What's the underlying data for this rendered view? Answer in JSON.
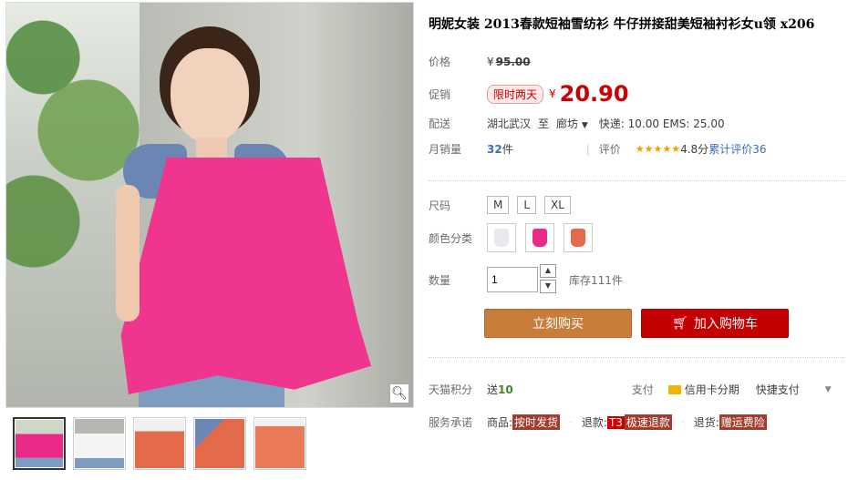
{
  "product": {
    "title": "明妮女装 2013春款短袖雪纺衫 牛仔拼接甜美短袖衬衫女u领 x206"
  },
  "price_row": {
    "label": "价格",
    "currency": "¥",
    "original": "95.00"
  },
  "promo_row": {
    "label": "促销",
    "badge": "限时两天",
    "currency": "¥",
    "price": "20.90"
  },
  "delivery_row": {
    "label": "配送",
    "from": "湖北武汉",
    "to_word": "至",
    "destination": "廊坊",
    "fees": "快递: 10.00 EMS: 25.00"
  },
  "sales_row": {
    "label": "月销量",
    "count": "32",
    "unit": "件",
    "rating_label": "评价",
    "stars": "★★★★★",
    "rating_text": "4.8分",
    "reviews": "累计评价36"
  },
  "size_row": {
    "label": "尺码",
    "options": [
      "M",
      "L",
      "XL"
    ]
  },
  "color_row": {
    "label": "颜色分类",
    "colors": [
      "#e8e8ee",
      "#ea2a86",
      "#e36b4c"
    ]
  },
  "quantity_row": {
    "label": "数量",
    "value": "1",
    "stock": "库存111件"
  },
  "buttons": {
    "buy_now": "立刻购买",
    "add_cart": "加入购物车"
  },
  "points_row": {
    "label": "天猫积分",
    "send": "送",
    "points": "10",
    "pay_label": "支付",
    "credit": "信用卡分期",
    "quick_pay": "快捷支付"
  },
  "service_row": {
    "label": "服务承诺",
    "item1_pre": "商品:",
    "item1_tag": "按时发货",
    "item2_pre": "退款:",
    "item2_tag1": "T3",
    "item2_tag2": "极速退款",
    "item3_pre": "退货:",
    "item3_tag": "赠运费险"
  },
  "icons": {
    "zoom": "magnifier-icon",
    "cart": "cart-icon",
    "dropdown": "chevron-down-icon"
  }
}
